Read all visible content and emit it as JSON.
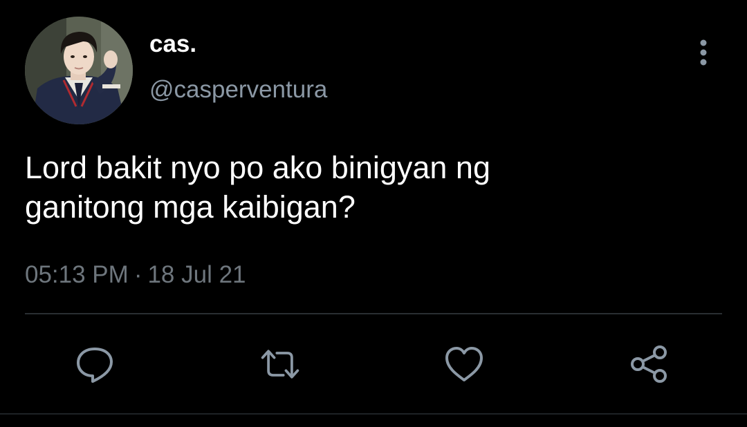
{
  "author": {
    "display_name": "cas.",
    "handle": "@casperventura",
    "avatar_icon": "profile-photo"
  },
  "tweet": {
    "text_lines": [
      "Lord bakit nyo po ako binigyan ng",
      "ganitong mga kaibigan?"
    ],
    "time": "05:13 PM",
    "separator": "·",
    "date": "18 Jul 21"
  },
  "actions": [
    {
      "icon": "reply-icon"
    },
    {
      "icon": "retweet-icon"
    },
    {
      "icon": "like-icon"
    },
    {
      "icon": "share-icon"
    }
  ],
  "colors": {
    "background": "#000000",
    "text_primary": "#ffffff",
    "text_secondary": "#8b98a5",
    "icon": "#8b98a5",
    "divider": "#2a2f33"
  }
}
